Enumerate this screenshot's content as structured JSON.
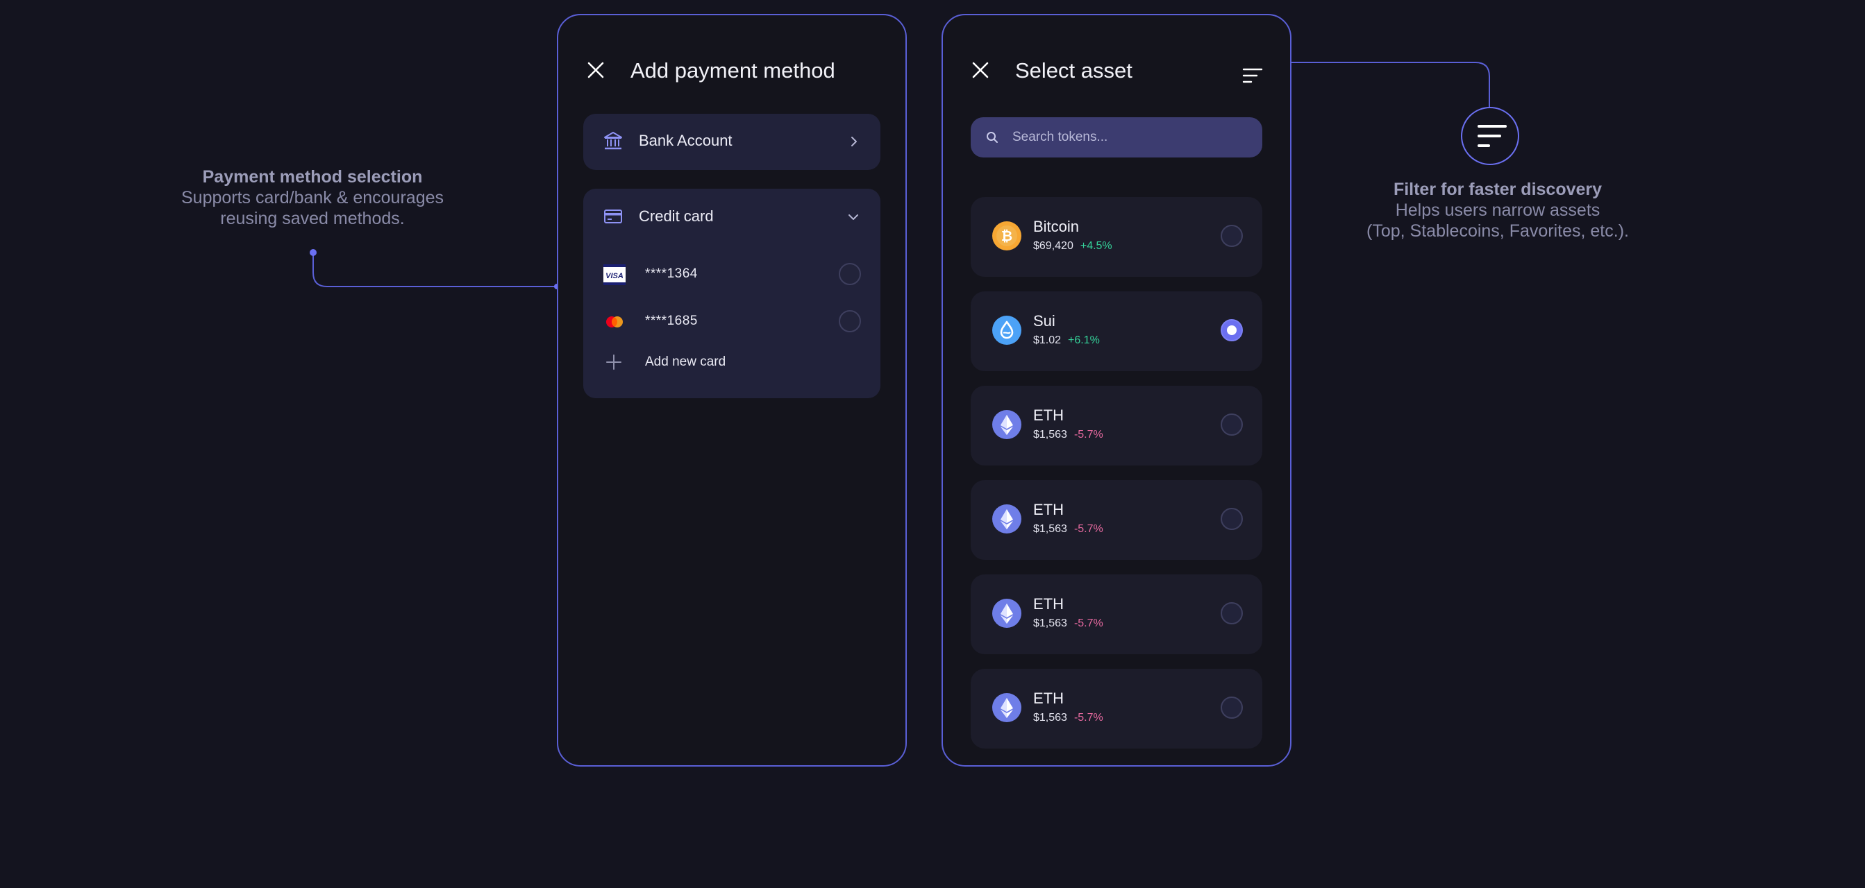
{
  "colors": {
    "background": "#14141f",
    "accent": "#5a5fd6",
    "positive": "#35d39a",
    "negative": "#e86aa0"
  },
  "annotations": {
    "payment": {
      "title": "Payment method selection",
      "line1": "Supports card/bank & encourages",
      "line2": "reusing saved methods."
    },
    "filter": {
      "title": "Filter for faster discovery",
      "line1": "Helps users narrow assets",
      "line2": "(Top, Stablecoins, Favorites, etc.)."
    }
  },
  "payment_panel": {
    "title": "Add payment method",
    "close_icon": "close-icon",
    "bank": {
      "label": "Bank Account",
      "icon": "bank-icon"
    },
    "credit_card": {
      "label": "Credit card",
      "icon": "credit-card-icon",
      "cards": [
        {
          "brand": "visa",
          "number": "****1364",
          "selected": false
        },
        {
          "brand": "mastercard",
          "number": "****1685",
          "selected": false
        }
      ],
      "add_label": "Add new card"
    }
  },
  "asset_panel": {
    "title": "Select asset",
    "close_icon": "close-icon",
    "sort_icon": "sort-filter-icon",
    "search_placeholder": "Search tokens...",
    "assets": [
      {
        "name": "Bitcoin",
        "price": "$69,420",
        "change": "+4.5%",
        "trend": "up",
        "icon": "bitcoin-icon",
        "selected": false
      },
      {
        "name": "Sui",
        "price": "$1.02",
        "change": "+6.1%",
        "trend": "up",
        "icon": "sui-icon",
        "selected": true
      },
      {
        "name": "ETH",
        "price": "$1,563",
        "change": "-5.7%",
        "trend": "down",
        "icon": "ethereum-icon",
        "selected": false
      },
      {
        "name": "ETH",
        "price": "$1,563",
        "change": "-5.7%",
        "trend": "down",
        "icon": "ethereum-icon",
        "selected": false
      },
      {
        "name": "ETH",
        "price": "$1,563",
        "change": "-5.7%",
        "trend": "down",
        "icon": "ethereum-icon",
        "selected": false
      },
      {
        "name": "ETH",
        "price": "$1,563",
        "change": "-5.7%",
        "trend": "down",
        "icon": "ethereum-icon",
        "selected": false
      }
    ]
  }
}
